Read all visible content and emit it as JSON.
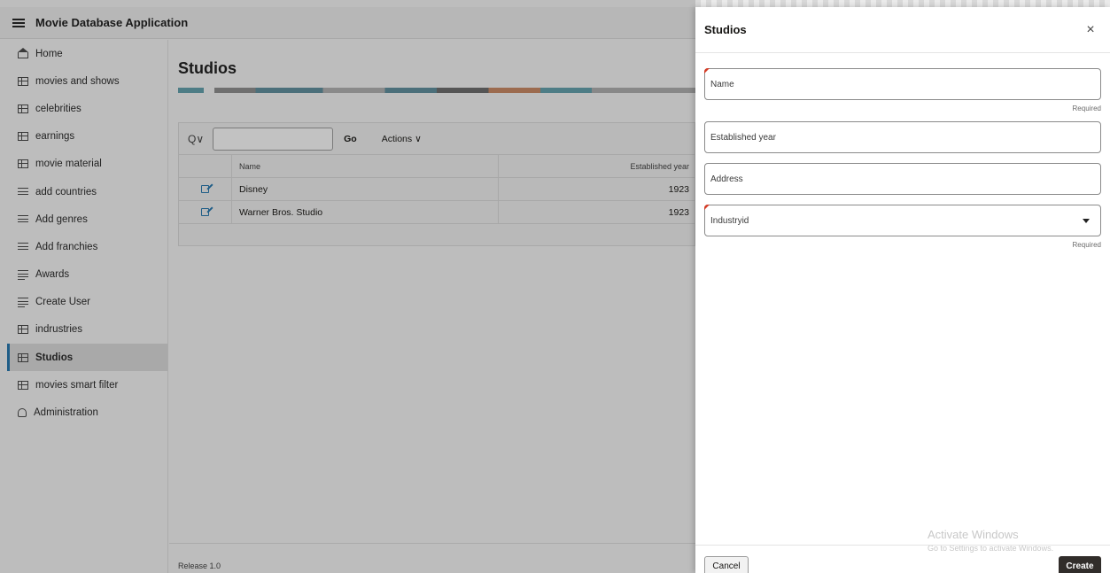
{
  "app": {
    "title": "Movie Database Application"
  },
  "sidebar": {
    "items": [
      {
        "label": "Home",
        "icon": "home-icon"
      },
      {
        "label": "movies and shows",
        "icon": "grid-icon"
      },
      {
        "label": "celebrities",
        "icon": "grid-icon"
      },
      {
        "label": "earnings",
        "icon": "grid-icon"
      },
      {
        "label": "movie material",
        "icon": "grid-icon"
      },
      {
        "label": "add countries",
        "icon": "form-icon"
      },
      {
        "label": "Add genres",
        "icon": "form-icon"
      },
      {
        "label": "Add franchies",
        "icon": "form-icon"
      },
      {
        "label": "Awards",
        "icon": "form-icon"
      },
      {
        "label": "Create User",
        "icon": "form-icon"
      },
      {
        "label": "indrustries",
        "icon": "grid-icon"
      },
      {
        "label": "Studios",
        "icon": "grid-icon",
        "active": true
      },
      {
        "label": "movies smart filter",
        "icon": "smart-filter-icon"
      },
      {
        "label": "Administration",
        "icon": "admin-icon"
      }
    ]
  },
  "page": {
    "title": "Studios",
    "release": "Release 1.0"
  },
  "report": {
    "search_icon": "Q∨",
    "search_value": "",
    "go_label": "Go",
    "actions_label": "Actions ∨",
    "columns": [
      "Name",
      "Established year"
    ],
    "rows": [
      {
        "name": "Disney",
        "year": "1923"
      },
      {
        "name": "Warner Bros. Studio",
        "year": "1923"
      }
    ]
  },
  "drawer": {
    "title": "Studios",
    "close": "×",
    "fields": {
      "name": {
        "label": "Name",
        "hint": "Required"
      },
      "established": {
        "label": "Established year"
      },
      "address": {
        "label": "Address"
      },
      "industry": {
        "label": "Industryid",
        "hint": "Required"
      }
    },
    "cancel_label": "Cancel",
    "create_label": "Create"
  },
  "watermark": {
    "line1": "Activate Windows",
    "line2": "Go to Settings to activate Windows."
  }
}
